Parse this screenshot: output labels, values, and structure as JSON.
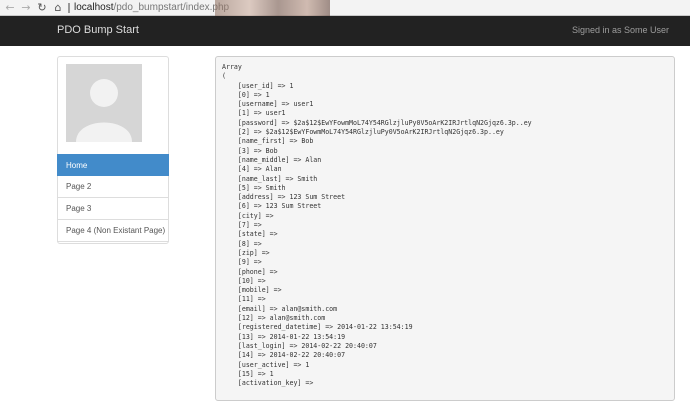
{
  "browser": {
    "back_icon": "back-arrow",
    "forward_icon": "forward-arrow",
    "reload_icon": "reload",
    "home_icon": "home",
    "url_host": "localhost",
    "url_path": "/pdo_bumpstart/index.php"
  },
  "navbar": {
    "brand": "PDO Bump Start",
    "status": "Signed in as Some User"
  },
  "sidebar": {
    "items": [
      {
        "label": "Home",
        "active": true
      },
      {
        "label": "Page 2"
      },
      {
        "label": "Page 3"
      },
      {
        "label": "Page 4 (Non Existant Page)"
      }
    ]
  },
  "content": {
    "lines": [
      "Array",
      "(",
      "    [user_id] => 1",
      "    [0] => 1",
      "    [username] => user1",
      "    [1] => user1",
      "    [password] => $2a$12$EwYFowmMoL74Y54RGlzjluPy0V5oArK2IRJrtlqN2Gjqz6.3p..ey",
      "    [2] => $2a$12$EwYFowmMoL74Y54RGlzjluPy0V5oArK2IRJrtlqN2Gjqz6.3p..ey",
      "    [name_first] => Bob",
      "    [3] => Bob",
      "    [name_middle] => Alan",
      "    [4] => Alan",
      "    [name_last] => Smith",
      "    [5] => Smith",
      "    [address] => 123 Sum Street",
      "    [6] => 123 Sum Street",
      "    [city] =>",
      "    [7] =>",
      "    [state] =>",
      "    [8] =>",
      "    [zip] =>",
      "    [9] =>",
      "    [phone] =>",
      "    [10] =>",
      "    [mobile] =>",
      "    [11] =>",
      "    [email] => alan@smith.com",
      "    [12] => alan@smith.com",
      "    [registered_datetime] => 2014-01-22 13:54:19",
      "    [13] => 2014-01-22 13:54:19",
      "    [last_login] => 2014-02-22 20:40:07",
      "    [14] => 2014-02-22 20:40:07",
      "    [user_active] => 1",
      "    [15] => 1",
      "    [activation_key] =>"
    ]
  }
}
